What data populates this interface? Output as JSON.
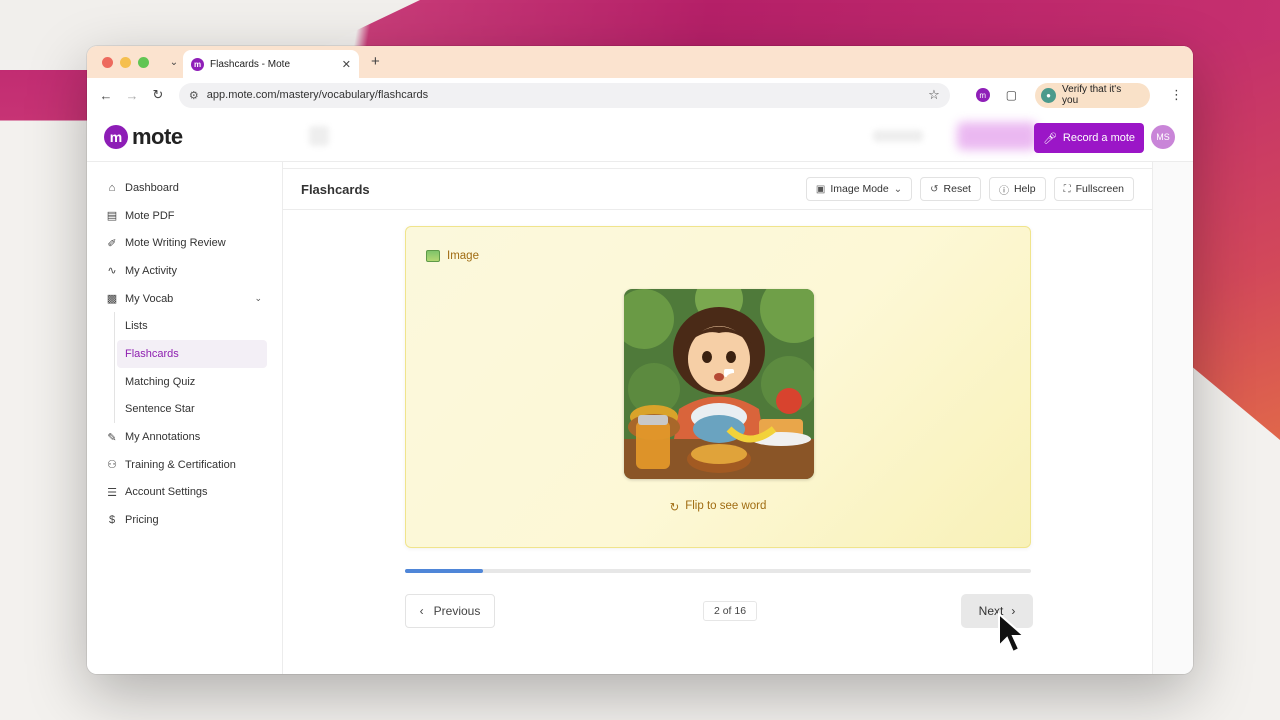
{
  "browser": {
    "tab_title": "Flashcards - Mote",
    "url": "app.mote.com/mastery/vocabulary/flashcards",
    "verify_label": "Verify that it's you"
  },
  "header": {
    "logo_text": "mote",
    "record_label": "Record a mote",
    "avatar_initials": "MS"
  },
  "sidebar": {
    "items": [
      {
        "label": "Dashboard",
        "icon": "home-icon"
      },
      {
        "label": "Mote PDF",
        "icon": "document-icon"
      },
      {
        "label": "Mote Writing Review",
        "icon": "pen-icon"
      },
      {
        "label": "My Activity",
        "icon": "activity-icon"
      },
      {
        "label": "My Vocab",
        "icon": "book-icon"
      }
    ],
    "vocab_sub": [
      {
        "label": "Lists"
      },
      {
        "label": "Flashcards",
        "active": true
      },
      {
        "label": "Matching Quiz"
      },
      {
        "label": "Sentence Star"
      }
    ],
    "items_bottom": [
      {
        "label": "My Annotations",
        "icon": "highlighter-icon"
      },
      {
        "label": "Training & Certification",
        "icon": "users-icon"
      },
      {
        "label": "Account Settings",
        "icon": "sliders-icon"
      },
      {
        "label": "Pricing",
        "icon": "dollar-icon"
      }
    ]
  },
  "page": {
    "title": "Flashcards",
    "toolbar": {
      "mode": "Image Mode",
      "reset": "Reset",
      "help": "Help",
      "fullscreen": "Fullscreen"
    }
  },
  "card": {
    "tag": "Image",
    "flip_hint": "Flip to see word"
  },
  "progress": {
    "current": 2,
    "total": 16,
    "fraction": 0.125,
    "label": "2 of 16"
  },
  "nav": {
    "previous": "Previous",
    "next": "Next"
  },
  "colors": {
    "brand": "#8d1db6",
    "record": "#9b16c7",
    "card_bg": "#fdf8d6",
    "progress": "#4f86d8"
  }
}
